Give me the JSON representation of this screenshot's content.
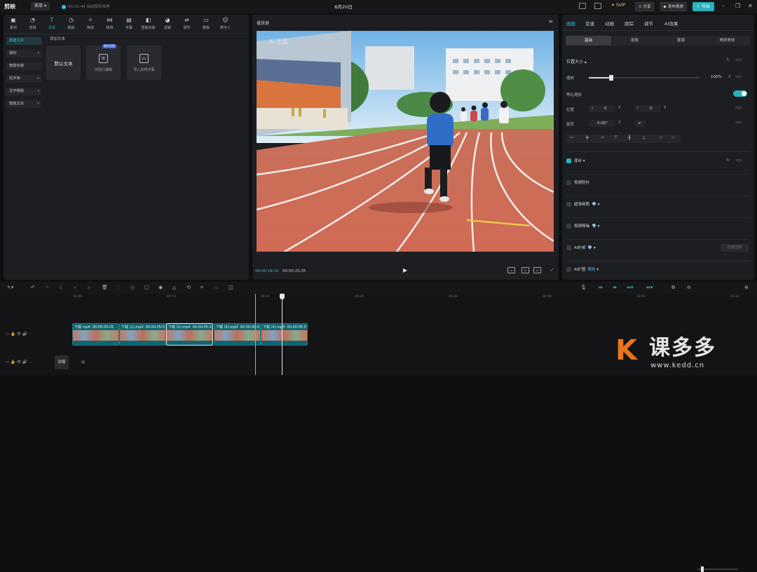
{
  "titlebar": {
    "app_name": "剪映",
    "menu_label": "菜单",
    "autosave_text": "03:31:44 自动保存本地",
    "doc_title": "6月20日",
    "svip_label": "SVIP",
    "share_label": "分享",
    "publish_label": "发布视频",
    "export_label": "导出"
  },
  "toolbar": {
    "items": [
      {
        "label": "素材",
        "icon": "media-icon",
        "glyph": "▣"
      },
      {
        "label": "音频",
        "icon": "audio-icon",
        "glyph": "◔"
      },
      {
        "label": "文本",
        "icon": "text-icon",
        "glyph": "T"
      },
      {
        "label": "贴纸",
        "icon": "sticker-icon",
        "glyph": "◷"
      },
      {
        "label": "特效",
        "icon": "effects-icon",
        "glyph": "✧"
      },
      {
        "label": "转场",
        "icon": "transition-icon",
        "glyph": "⋈"
      },
      {
        "label": "字幕",
        "icon": "subtitle-icon",
        "glyph": "▤"
      },
      {
        "label": "智能包装",
        "icon": "smart-pack-icon",
        "glyph": "◧"
      },
      {
        "label": "滤镜",
        "icon": "filter-icon",
        "glyph": "◕"
      },
      {
        "label": "调节",
        "icon": "adjust-icon",
        "glyph": "⇌"
      },
      {
        "label": "模板",
        "icon": "template-icon",
        "glyph": "▭"
      },
      {
        "label": "数字人",
        "icon": "avatar-icon",
        "glyph": "☺"
      }
    ],
    "active_index": 2
  },
  "text_sidebar": {
    "items": [
      {
        "label": "新建文本",
        "has_arrow": false
      },
      {
        "label": "我的",
        "has_arrow": true
      },
      {
        "label": "智能包装",
        "has_arrow": false
      },
      {
        "label": "花字库",
        "has_arrow": true
      },
      {
        "label": "文字模板",
        "has_arrow": true
      },
      {
        "label": "智能文本",
        "has_arrow": true
      }
    ],
    "active_index": 0
  },
  "text_panel": {
    "section_title": "添加文本",
    "cards": [
      {
        "label": "默认文本"
      },
      {
        "label": "识别口播稿",
        "badge": "限时免费"
      },
      {
        "label": "导入本地字幕"
      }
    ]
  },
  "player": {
    "title": "播放器",
    "watermark": "AI 生成",
    "current_time": "00:00:19:14",
    "duration": "00:00:25:05",
    "controls": [
      "原比例",
      "全屏"
    ]
  },
  "inspector": {
    "tabs": [
      "画面",
      "变速",
      "动画",
      "跟踪",
      "调节",
      "AI效果"
    ],
    "active_tab": 0,
    "subtabs": [
      "基础",
      "抠像",
      "蒙版",
      "美颜美体"
    ],
    "active_subtab": 0,
    "position_size_label": "位置大小",
    "scale_label": "缩放",
    "scale_value": "100%",
    "scale_fraction": 0.2,
    "uniform_scale_label": "等比缩放",
    "position_label": "位置",
    "pos_x_label": "X",
    "pos_x_value": "0",
    "pos_y_label": "Y",
    "pos_y_value": "0",
    "rotate_label": "旋转",
    "rotate_value": "0.00°",
    "blend_label": "混合",
    "sections": [
      {
        "label": "视频防抖",
        "badge": ""
      },
      {
        "label": "超清画质",
        "badge": "💎"
      },
      {
        "label": "视频降噪",
        "badge": "💎"
      },
      {
        "label": "AI补帧",
        "badge": "💎"
      },
      {
        "label": "AI扩图",
        "badge": "限免"
      }
    ],
    "apply_label": "应用全部"
  },
  "timeline": {
    "ruler_ticks": [
      "00:00",
      "00:10",
      "00:20",
      "00:30",
      "00:40",
      "00:50",
      "01:00",
      "01:10"
    ],
    "clips": [
      {
        "name": "下载.mp4",
        "duration": "00:00:05:01"
      },
      {
        "name": "下载 (1).mp4",
        "duration": "00:00:05:0"
      },
      {
        "name": "下载 (2).mp4",
        "duration": "00:00:05:0"
      },
      {
        "name": "下载 (3).mp4",
        "duration": "00:00:05:0"
      },
      {
        "name": "下载 (4).mp4",
        "duration": "00:00:05:0"
      }
    ],
    "selected_clip": 2,
    "cover_label": "封面"
  },
  "brand": {
    "mark": "K",
    "name": "课多多",
    "url": "www.kedd.cn"
  },
  "colors": {
    "accent": "#26b3bb",
    "brand_orange": "#e9741e"
  }
}
